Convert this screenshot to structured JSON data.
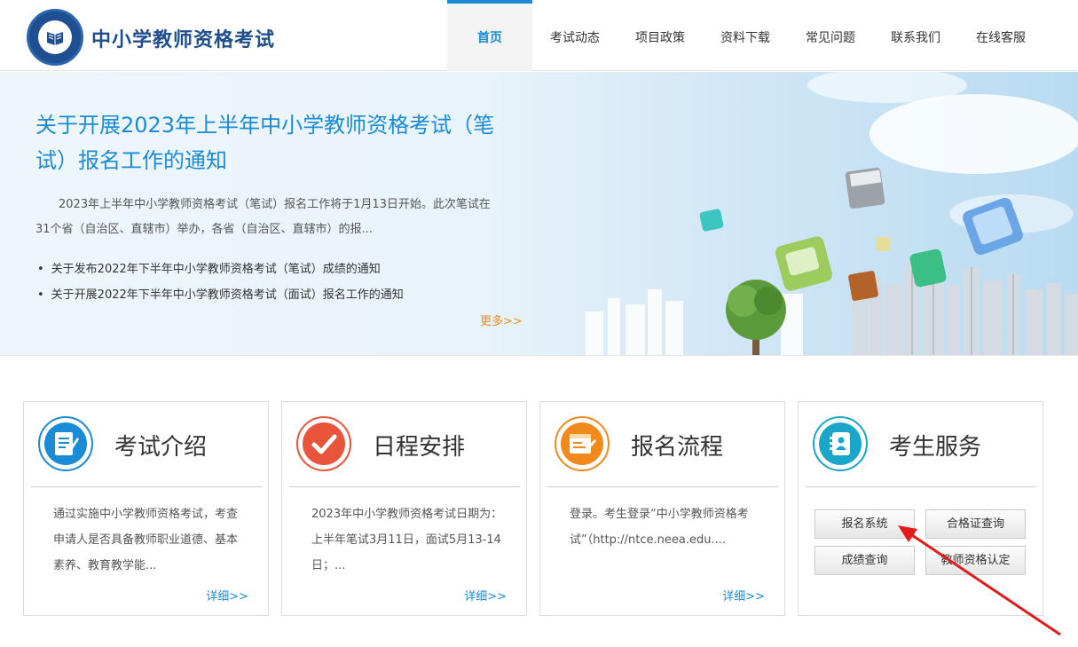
{
  "header": {
    "site_title": "中小学教师资格考试",
    "nav": [
      {
        "label": "首页",
        "active": true
      },
      {
        "label": "考试动态"
      },
      {
        "label": "项目政策"
      },
      {
        "label": "资料下载"
      },
      {
        "label": "常见问题"
      },
      {
        "label": "联系我们"
      },
      {
        "label": "在线客服"
      }
    ]
  },
  "banner": {
    "title": "关于开展2023年上半年中小学教师资格考试（笔试）报名工作的通知",
    "summary": "2023年上半年中小学教师资格考试（笔试）报名工作将于1月13日开始。此次笔试在31个省（自治区、直辖市）举办，各省（自治区、直辖市）的报...",
    "links": [
      "关于发布2022年下半年中小学教师资格考试（笔试）成绩的通知",
      "关于开展2022年下半年中小学教师资格考试（面试）报名工作的通知"
    ],
    "more": "更多>>"
  },
  "cards": [
    {
      "title": "考试介绍",
      "text": "通过实施中小学教师资格考试，考查申请人是否具备教师职业道德、基本素养、教育教学能...",
      "more": "详细>>",
      "icon": "document-icon",
      "color": "#1a8bd4"
    },
    {
      "title": "日程安排",
      "text": "2023年中小学教师资格考试日期为：上半年笔试3月11日，面试5月13-14日；...",
      "more": "详细>>",
      "icon": "checkmark-icon",
      "color": "#e8553a"
    },
    {
      "title": "报名流程",
      "text": "登录。考生登录“中小学教师资格考试”（http://ntce.neea.edu....",
      "more": "详细>>",
      "icon": "form-icon",
      "color": "#f08a1c"
    },
    {
      "title": "考生服务",
      "icon": "contacts-icon",
      "color": "#1aa6c8",
      "buttons": [
        "报名系统",
        "合格证查询",
        "成绩查询",
        "教师资格认定"
      ]
    }
  ]
}
